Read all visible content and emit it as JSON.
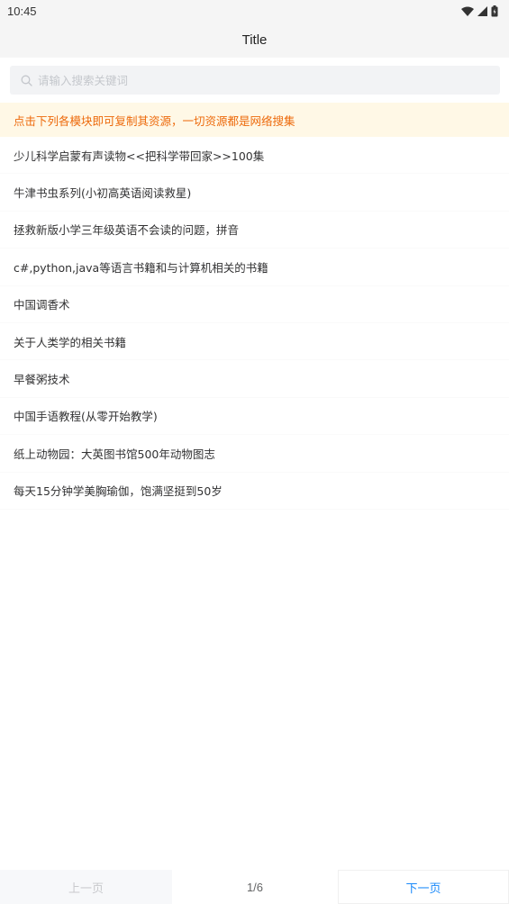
{
  "status_bar": {
    "time": "10:45",
    "icons": [
      "wifi-icon",
      "signal-icon",
      "battery-icon"
    ]
  },
  "header": {
    "title": "Title"
  },
  "search": {
    "placeholder": "请输入搜索关键词",
    "value": "",
    "icon": "search-icon"
  },
  "notice": {
    "text": "点击下列各模块即可复制其资源，一切资源都是网络搜集"
  },
  "list": {
    "items": [
      {
        "label": "少儿科学启蒙有声读物<<把科学带回家>>100集"
      },
      {
        "label": "牛津书虫系列(小初高英语阅读救星)"
      },
      {
        "label": "拯救新版小学三年级英语不会读的问题，拼音"
      },
      {
        "label": "c#,python,java等语言书籍和与计算机相关的书籍"
      },
      {
        "label": "中国调香术"
      },
      {
        "label": "关于人类学的相关书籍"
      },
      {
        "label": "早餐粥技术"
      },
      {
        "label": "中国手语教程(从零开始教学)"
      },
      {
        "label": "纸上动物园：大英图书馆500年动物图志"
      },
      {
        "label": "每天15分钟学美胸瑜伽，饱满坚挺到50岁"
      }
    ]
  },
  "pagination": {
    "prev_label": "上一页",
    "page_text": "1/6",
    "next_label": "下一页",
    "current_page": 1,
    "total_pages": 6
  },
  "colors": {
    "notice_text": "#ed6a0c",
    "notice_bg": "#fff8e6",
    "next_button": "#1989fa",
    "disabled_text": "#c8c9cc"
  }
}
